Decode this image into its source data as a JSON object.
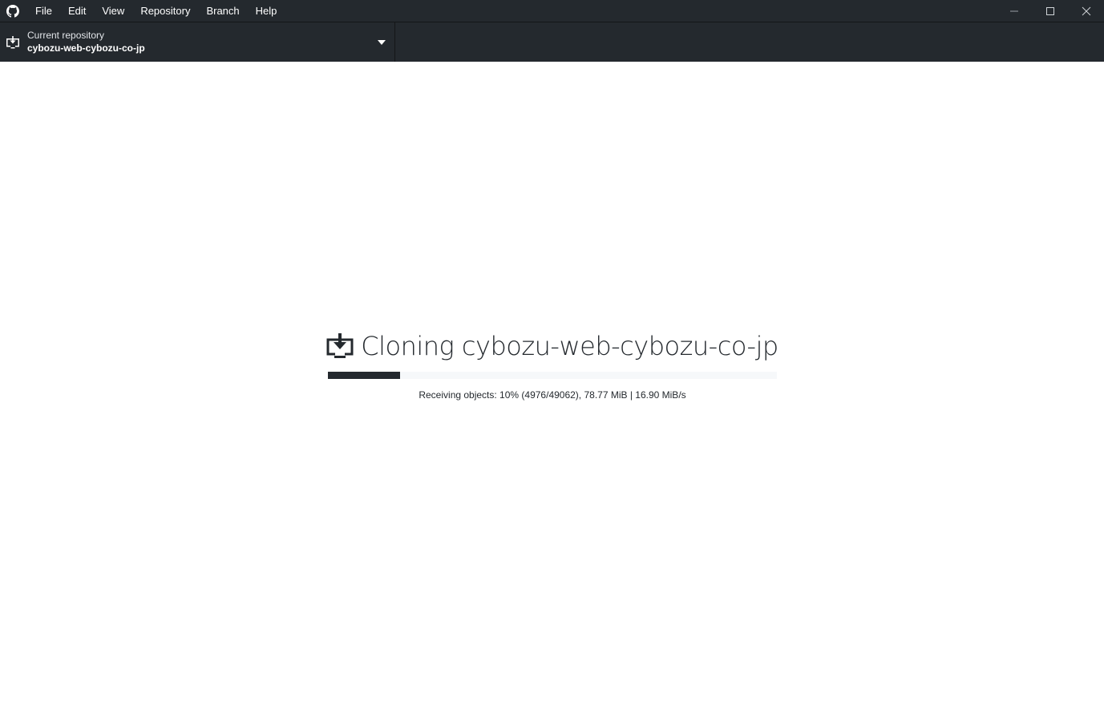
{
  "menu": {
    "items": [
      "File",
      "Edit",
      "View",
      "Repository",
      "Branch",
      "Help"
    ]
  },
  "window_controls": {
    "icons": [
      "minimize-icon",
      "maximize-icon",
      "close-icon"
    ]
  },
  "toolbar": {
    "repo_label": "Current repository",
    "repo_name": "cybozu-web-cybozu-co-jp"
  },
  "clone": {
    "title": "Cloning cybozu-web-cybozu-co-jp",
    "progress_fraction": 0.16,
    "description": "Receiving objects: 10% (4976/49062), 78.77 MiB | 16.90 MiB/s"
  },
  "colors": {
    "chrome_bg": "#24292e",
    "progress_fill": "#24292e",
    "progress_track": "#f6f8fa"
  }
}
